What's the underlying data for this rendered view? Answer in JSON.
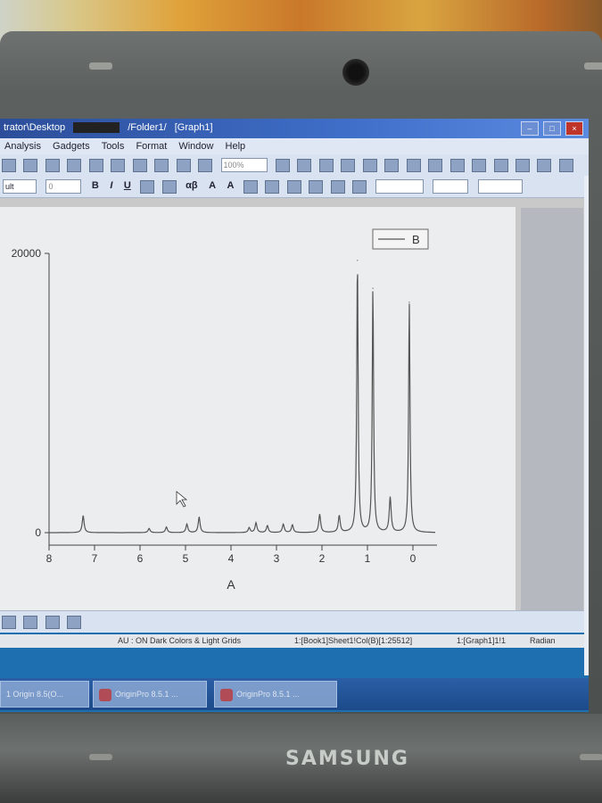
{
  "window": {
    "title_path": "trator\\Desktop",
    "title_folder": "/Folder1/",
    "title_graph": "[Graph1]"
  },
  "menu": [
    "Analysis",
    "Gadgets",
    "Tools",
    "Format",
    "Window",
    "Help"
  ],
  "toolbar": {
    "zoom": "100%",
    "font_combo": "ult",
    "size_combo": "0",
    "bold": "B",
    "italic": "I",
    "underline": "U",
    "alpha": "αβ",
    "font_a": "A",
    "font_a2": "A"
  },
  "laptop": {
    "brand": "SAMSUNG"
  },
  "chart_data": {
    "type": "line",
    "xlabel": "A",
    "ylabel": "",
    "legend": [
      "B"
    ],
    "legend_position": "top-right",
    "x_ticks": [
      8,
      7,
      6,
      5,
      4,
      3,
      2,
      1,
      0
    ],
    "y_ticks": [
      0,
      20000
    ],
    "xlim": [
      8,
      0
    ],
    "ylim": [
      0,
      20000
    ],
    "x_reversed": true,
    "series": [
      {
        "name": "B",
        "color": "#555555",
        "peaks": [
          {
            "x": 7.25,
            "y": 1200
          },
          {
            "x": 5.8,
            "y": 300
          },
          {
            "x": 5.42,
            "y": 400
          },
          {
            "x": 4.97,
            "y": 600
          },
          {
            "x": 4.7,
            "y": 1100
          },
          {
            "x": 3.6,
            "y": 350
          },
          {
            "x": 3.45,
            "y": 700
          },
          {
            "x": 3.2,
            "y": 500
          },
          {
            "x": 2.85,
            "y": 600
          },
          {
            "x": 2.65,
            "y": 550
          },
          {
            "x": 2.05,
            "y": 1300
          },
          {
            "x": 1.62,
            "y": 1200
          },
          {
            "x": 1.22,
            "y": 19500
          },
          {
            "x": 0.88,
            "y": 17500
          },
          {
            "x": 0.5,
            "y": 2500
          },
          {
            "x": 0.08,
            "y": 16500
          }
        ]
      }
    ]
  },
  "status": {
    "au": "AU : ON  Dark Colors & Light Grids",
    "cell": "1:[Book1]Sheet1!Col(B)[1:25512]",
    "graph": "1:[Graph1]1!1",
    "unit": "Radian"
  },
  "taskbar": [
    {
      "label": "1 Origin 8.5(O..."
    },
    {
      "label": "OriginPro 8.5.1 ..."
    },
    {
      "label": "OriginPro 8.5.1 ..."
    }
  ]
}
